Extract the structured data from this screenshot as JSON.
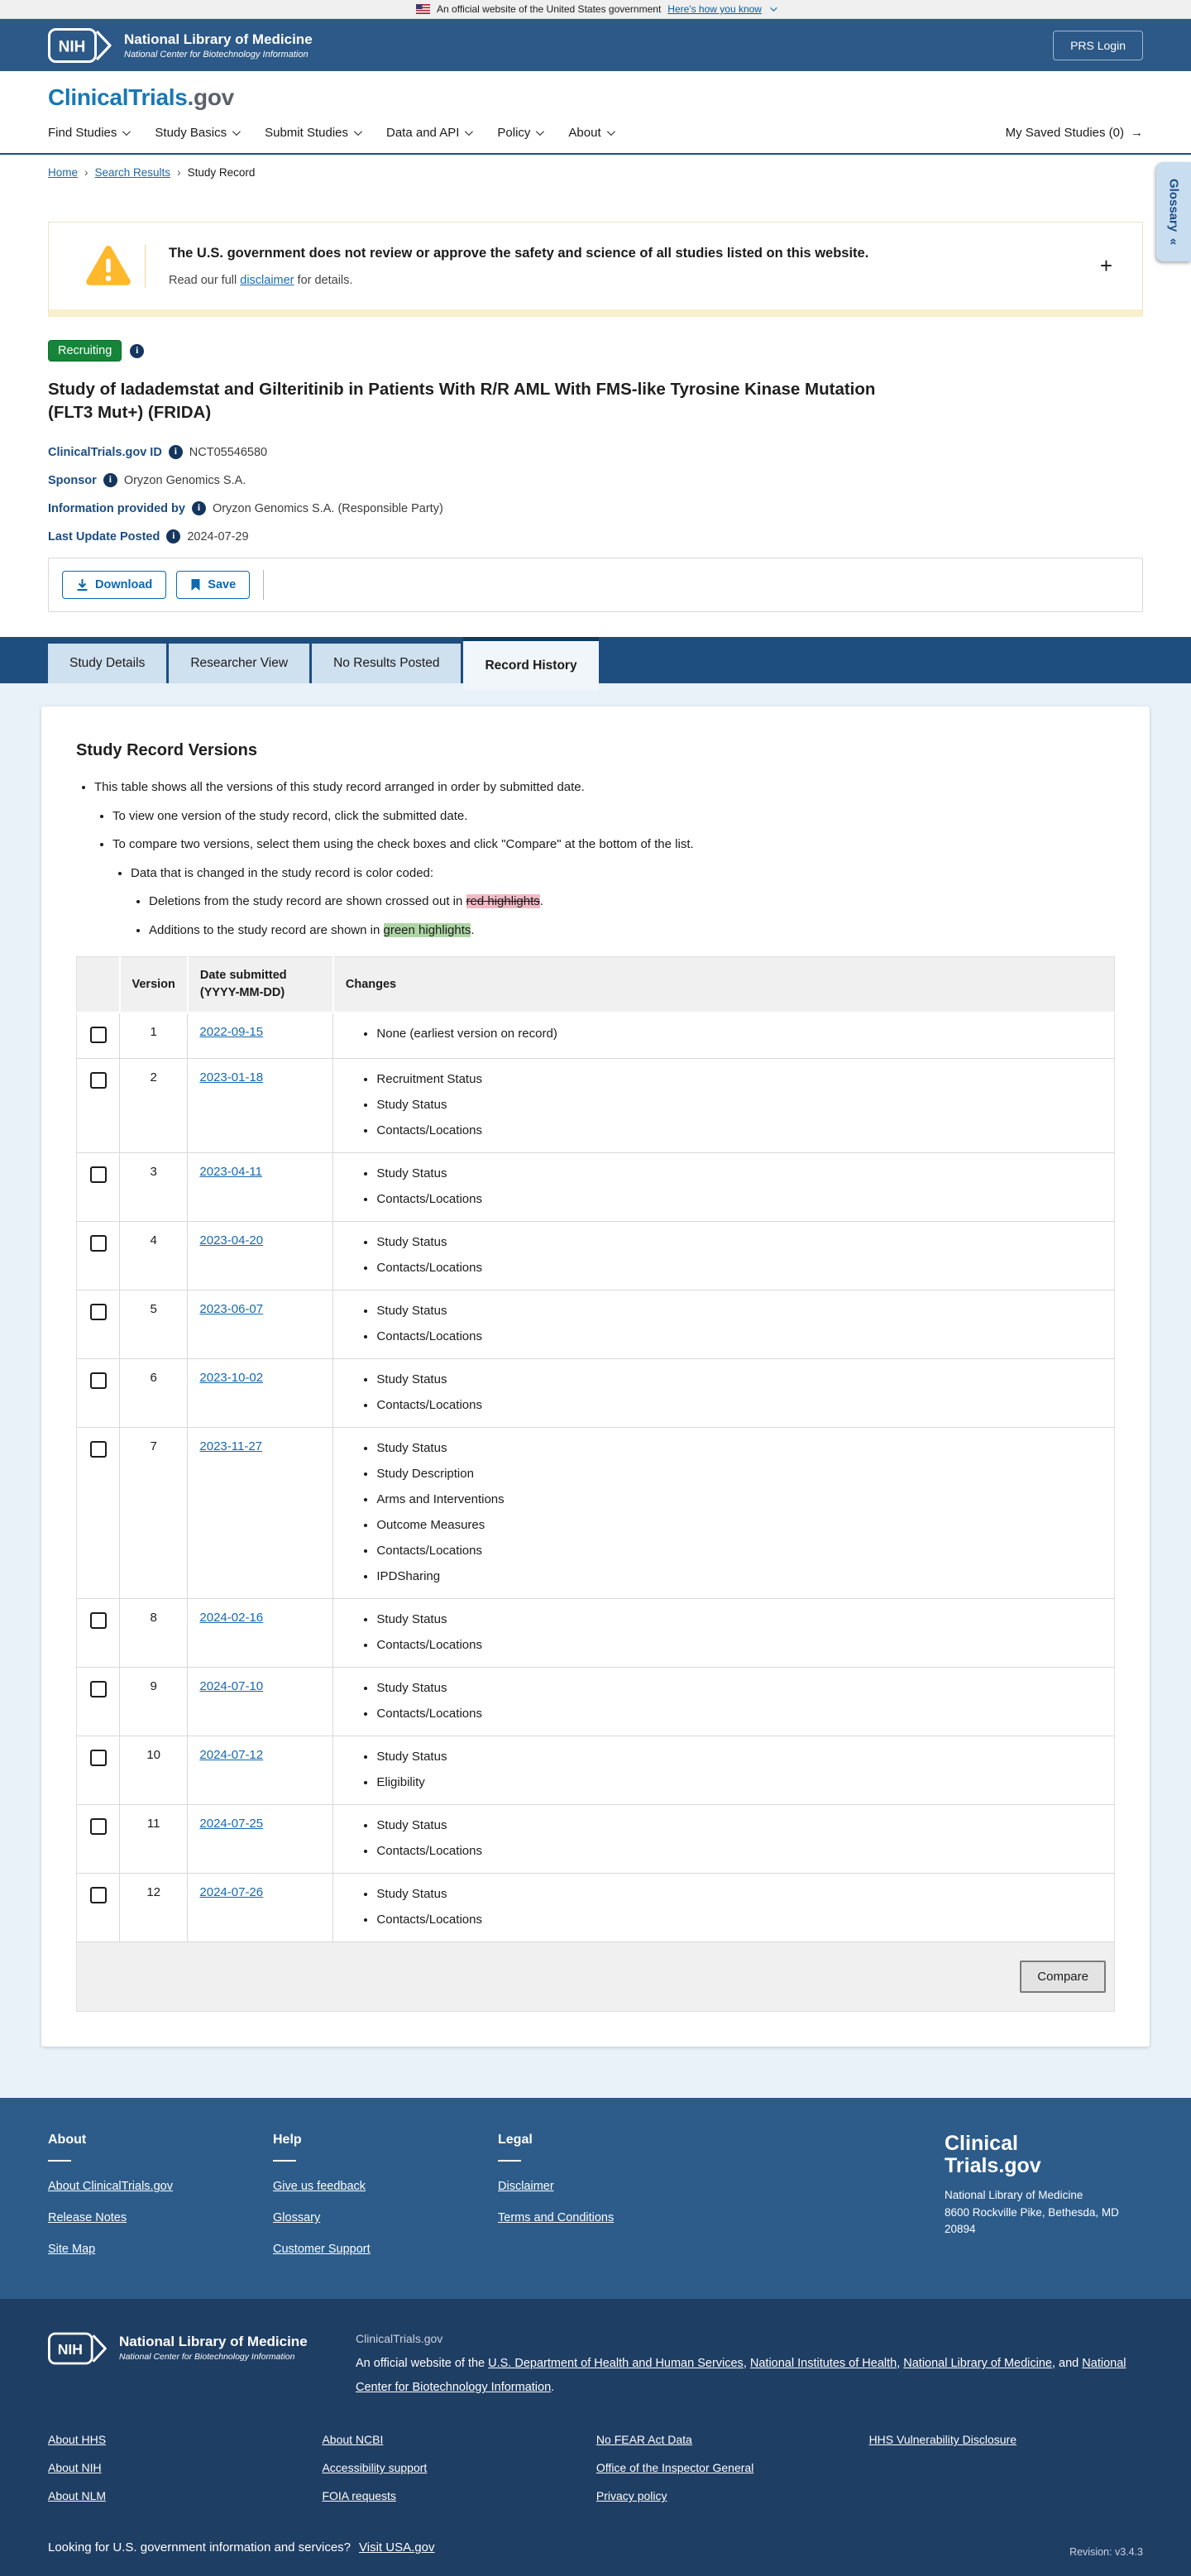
{
  "gov_banner": {
    "text": "An official website of the United States government",
    "link": "Here's how you know"
  },
  "nih_header": {
    "logo_text": "NIH",
    "title": "National Library of Medicine",
    "subtitle": "National Center for Biotechnology Information",
    "prs_login_label": "PRS Login"
  },
  "site_header": {
    "logo_primary": "ClinicalTrials",
    "logo_suffix": ".gov",
    "nav_items": [
      "Find Studies",
      "Study Basics",
      "Submit Studies",
      "Data and API",
      "Policy",
      "About"
    ],
    "saved_studies_label": "My Saved Studies (0)",
    "saved_studies_arrow": "→"
  },
  "breadcrumb": {
    "home": "Home",
    "search_results": "Search Results",
    "current": "Study Record"
  },
  "glossary_tab": {
    "label": "Glossary",
    "collapse_icon": "«"
  },
  "disclaimer_banner": {
    "headline": "The U.S. government does not review or approve the safety and science of all studies listed on this website.",
    "body_prefix": "Read our full ",
    "link_text": "disclaimer",
    "body_suffix": " for details.",
    "expand_icon": "+"
  },
  "study": {
    "status_badge": "Recruiting",
    "title": "Study of Iadademstat and Gilteritinib in Patients With R/R AML With FMS-like Tyrosine Kinase Mutation (FLT3 Mut+) (FRIDA)",
    "fields": [
      {
        "label": "ClinicalTrials.gov ID",
        "value": "NCT05546580"
      },
      {
        "label": "Sponsor",
        "value": "Oryzon Genomics S.A."
      },
      {
        "label": "Information provided by",
        "value": "Oryzon Genomics S.A. (Responsible Party)"
      },
      {
        "label": "Last Update Posted",
        "value": "2024-07-29"
      }
    ],
    "download_label": "Download",
    "save_label": "Save"
  },
  "tabs": [
    {
      "label": "Study Details",
      "active": false
    },
    {
      "label": "Researcher View",
      "active": false
    },
    {
      "label": "No Results Posted",
      "active": false
    },
    {
      "label": "Record History",
      "active": true
    }
  ],
  "record_versions": {
    "heading": "Study Record Versions",
    "notes": {
      "line1": "This table shows all the versions of this study record arranged in order by submitted date.",
      "line2": "To view one version of the study record, click the submitted date.",
      "line3": "To compare two versions, select them using the check boxes and click \"Compare\" at the bottom of the list.",
      "line4": "Data that is changed in the study record is color coded:",
      "line5_prefix": "Deletions from the study record are shown crossed out in ",
      "line5_highlight": "red highlights",
      "line5_suffix": ".",
      "line6_prefix": "Additions to the study record are shown in ",
      "line6_highlight": "green highlights",
      "line6_suffix": "."
    },
    "table": {
      "columns": {
        "version": "Version",
        "date_line1": "Date submitted",
        "date_line2": "(YYYY-MM-DD)",
        "changes": "Changes"
      },
      "rows": [
        {
          "version": "1",
          "date": "2022-09-15",
          "changes": [
            "None (earliest version on record)"
          ]
        },
        {
          "version": "2",
          "date": "2023-01-18",
          "changes": [
            "Recruitment Status",
            "Study Status",
            "Contacts/Locations"
          ]
        },
        {
          "version": "3",
          "date": "2023-04-11",
          "changes": [
            "Study Status",
            "Contacts/Locations"
          ]
        },
        {
          "version": "4",
          "date": "2023-04-20",
          "changes": [
            "Study Status",
            "Contacts/Locations"
          ]
        },
        {
          "version": "5",
          "date": "2023-06-07",
          "changes": [
            "Study Status",
            "Contacts/Locations"
          ]
        },
        {
          "version": "6",
          "date": "2023-10-02",
          "changes": [
            "Study Status",
            "Contacts/Locations"
          ]
        },
        {
          "version": "7",
          "date": "2023-11-27",
          "changes": [
            "Study Status",
            "Study Description",
            "Arms and Interventions",
            "Outcome Measures",
            "Contacts/Locations",
            "IPDSharing"
          ]
        },
        {
          "version": "8",
          "date": "2024-02-16",
          "changes": [
            "Study Status",
            "Contacts/Locations"
          ]
        },
        {
          "version": "9",
          "date": "2024-07-10",
          "changes": [
            "Study Status",
            "Contacts/Locations"
          ]
        },
        {
          "version": "10",
          "date": "2024-07-12",
          "changes": [
            "Study Status",
            "Eligibility"
          ]
        },
        {
          "version": "11",
          "date": "2024-07-25",
          "changes": [
            "Study Status",
            "Contacts/Locations"
          ]
        },
        {
          "version": "12",
          "date": "2024-07-26",
          "changes": [
            "Study Status",
            "Contacts/Locations"
          ]
        }
      ],
      "compare_label": "Compare"
    }
  },
  "footer": {
    "top_columns": [
      {
        "heading": "About",
        "links": [
          "About ClinicalTrials.gov",
          "Release Notes",
          "Site Map"
        ]
      },
      {
        "heading": "Help",
        "links": [
          "Give us feedback",
          "Glossary",
          "Customer Support"
        ]
      },
      {
        "heading": "Legal",
        "links": [
          "Disclaimer",
          "Terms and Conditions"
        ]
      }
    ],
    "brand": {
      "logo_line1": "Clinical",
      "logo_line2": "Trials.gov",
      "address_line1": "National Library of Medicine",
      "address_line2": "8600 Rockville Pike, Bethesda, MD",
      "address_line3": "20894"
    },
    "bottom": {
      "nih_logo_text": "NIH",
      "nlm_title": "National Library of Medicine",
      "nlm_subtitle": "National Center for Biotechnology Information",
      "site_name": "ClinicalTrials.gov",
      "statement_prefix": "An official website of the ",
      "link_hhs": "U.S. Department of Health and Human Services",
      "sep1": ", ",
      "link_nih": "National Institutes of Health",
      "sep2": ", ",
      "link_nlm": "National Library of Medicine",
      "sep3": ", and ",
      "link_ncbi": "National Center for Biotechnology Information",
      "statement_suffix": ".",
      "link_columns": [
        [
          "About HHS",
          "About NIH",
          "About NLM"
        ],
        [
          "About NCBI",
          "Accessibility support",
          "FOIA requests"
        ],
        [
          "No FEAR Act Data",
          "Office of the Inspector General",
          "Privacy policy"
        ],
        [
          "HHS Vulnerability Disclosure"
        ]
      ],
      "usa_prompt": "Looking for U.S. government information and services?",
      "usa_link": "Visit USA.gov",
      "revision": "Revision: v3.4.3"
    }
  },
  "colors": {
    "header_blue": "#2c5987",
    "accent_blue": "#1c4d82",
    "link_blue": "#1a6cb3",
    "recruiting_green": "#168539",
    "warning_amber": "#fdb82c",
    "red_highlight": "#f4b9c5",
    "green_highlight": "#aed6a5",
    "footer_mid_blue": "#2d5c8a",
    "footer_dark_blue": "#1f3e64"
  }
}
